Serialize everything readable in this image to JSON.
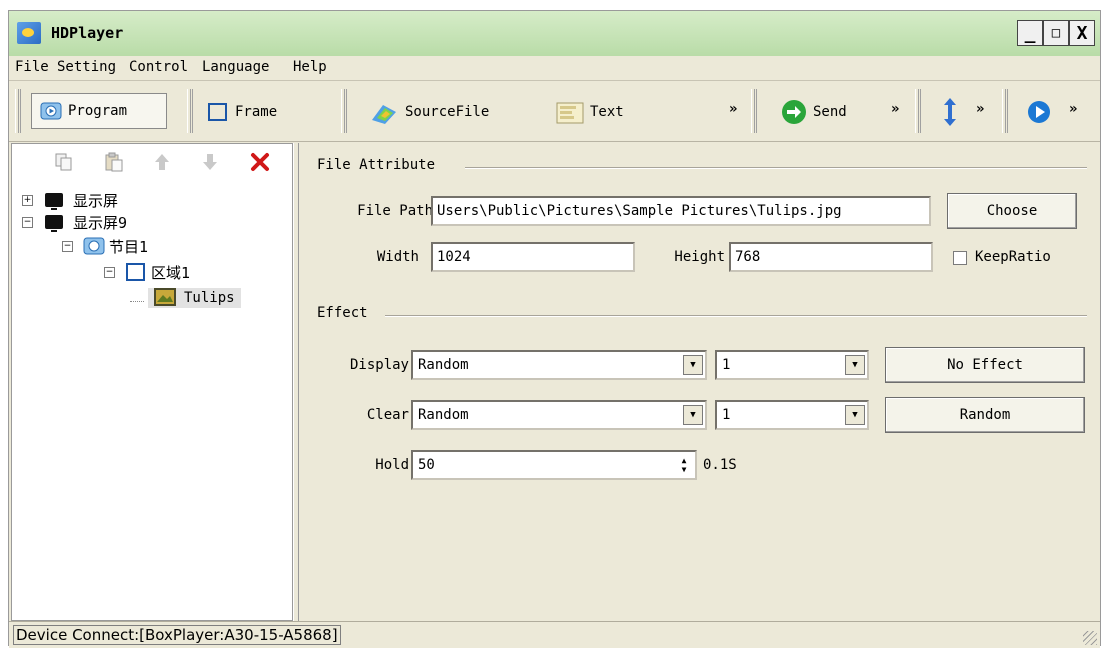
{
  "window": {
    "title": "HDPlayer"
  },
  "window_controls": {
    "minimize": "_",
    "maximize": "□",
    "close": "X"
  },
  "menu": [
    "File",
    "Setting",
    "Control",
    "Language",
    "Help"
  ],
  "toolbar": {
    "program": "Program",
    "frame": "Frame",
    "source_file": "SourceFile",
    "text": "Text",
    "send": "Send",
    "more": "»"
  },
  "tree": {
    "items": [
      {
        "label": "显示屏",
        "expander": "+"
      },
      {
        "label": "显示屏9",
        "expander": "−"
      },
      {
        "label": "节目1",
        "expander": "−"
      },
      {
        "label": "区域1",
        "expander": "−"
      },
      {
        "label": "Tulips",
        "expander": ""
      }
    ]
  },
  "file_attribute": {
    "group_title": "File Attribute",
    "file_path_label": "File Path",
    "file_path_value": "Users\\Public\\Pictures\\Sample Pictures\\Tulips.jpg",
    "choose_button": "Choose",
    "width_label": "Width",
    "width_value": "1024",
    "height_label": "Height",
    "height_value": "768",
    "keep_ratio_label": "KeepRatio"
  },
  "effect": {
    "group_title": "Effect",
    "display_label": "Display",
    "display_value": "Random",
    "display_speed": "1",
    "no_effect_button": "No Effect",
    "clear_label": "Clear",
    "clear_value": "Random",
    "clear_speed": "1",
    "random_button": "Random",
    "hold_label": "Hold",
    "hold_value": "50",
    "hold_unit": "0.1S"
  },
  "status": {
    "text": "Device Connect:[BoxPlayer:A30-15-A5868]"
  },
  "colors": {
    "titlebar": "#c6e4b5",
    "chrome": "#ece9d8",
    "delete_red": "#d01818",
    "send_green": "#2aa53a",
    "play_blue": "#1b78d4"
  }
}
